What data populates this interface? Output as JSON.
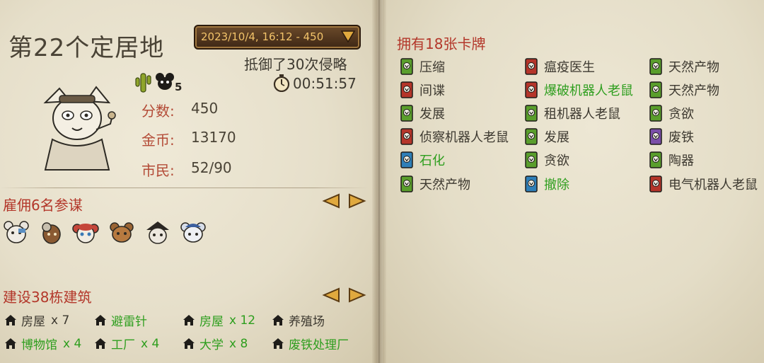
{
  "settlement": {
    "title": "第22个定居地",
    "date_label": "2023/10/4, 16:12 - 450",
    "defended": "抵御了30次侵略",
    "time": "00:51:57",
    "badge_count": "5"
  },
  "stats": [
    {
      "label": "分数:",
      "value": "450"
    },
    {
      "label": "金币:",
      "value": "13170"
    },
    {
      "label": "市民:",
      "value": "52/90"
    }
  ],
  "advisors": {
    "heading": "雇佣6名参谋",
    "count": 6
  },
  "buildings": {
    "heading": "建设38栋建筑",
    "items": [
      {
        "name": "房屋",
        "count": "x 7",
        "highlight": false
      },
      {
        "name": "避雷针",
        "count": "",
        "highlight": true
      },
      {
        "name": "房屋",
        "count": "x 12",
        "highlight": true
      },
      {
        "name": "养殖场",
        "count": "",
        "highlight": false
      },
      {
        "name": "博物馆",
        "count": "x 4",
        "highlight": true
      },
      {
        "name": "工厂",
        "count": "x 4",
        "highlight": true
      },
      {
        "name": "大学",
        "count": "x 8",
        "highlight": true
      },
      {
        "name": "废铁处理厂",
        "count": "",
        "highlight": true
      }
    ]
  },
  "cards": {
    "heading": "拥有18张卡牌",
    "columns": [
      [
        {
          "name": "压缩",
          "color": "green",
          "highlight": false
        },
        {
          "name": "间谍",
          "color": "red",
          "highlight": false
        },
        {
          "name": "发展",
          "color": "green",
          "highlight": false
        },
        {
          "name": "侦察机器人老鼠",
          "color": "red",
          "highlight": false
        },
        {
          "name": "石化",
          "color": "blue",
          "highlight": true
        },
        {
          "name": "天然产物",
          "color": "green",
          "highlight": false
        }
      ],
      [
        {
          "name": "瘟疫医生",
          "color": "red",
          "highlight": false
        },
        {
          "name": "爆破机器人老鼠",
          "color": "red",
          "highlight": true
        },
        {
          "name": "租机器人老鼠",
          "color": "green",
          "highlight": false
        },
        {
          "name": "发展",
          "color": "green",
          "highlight": false
        },
        {
          "name": "贪欲",
          "color": "green",
          "highlight": false
        },
        {
          "name": "撤除",
          "color": "blue",
          "highlight": true
        }
      ],
      [
        {
          "name": "天然产物",
          "color": "green",
          "highlight": false
        },
        {
          "name": "天然产物",
          "color": "green",
          "highlight": false
        },
        {
          "name": "贪欲",
          "color": "green",
          "highlight": false
        },
        {
          "name": "废铁",
          "color": "purple",
          "highlight": false
        },
        {
          "name": "陶器",
          "color": "green",
          "highlight": false
        },
        {
          "name": "电气机器人老鼠",
          "color": "red",
          "highlight": false
        }
      ]
    ]
  },
  "colors": {
    "accent_red": "#b3372a",
    "highlight_green": "#2e9e1e",
    "card_green": "#5a9e2c",
    "card_red": "#b5352a",
    "card_blue": "#2f7fb8",
    "card_purple": "#7a4ea8"
  }
}
